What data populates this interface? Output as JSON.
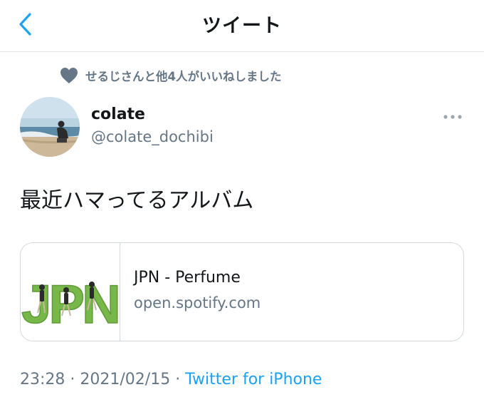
{
  "header": {
    "title": "ツイート"
  },
  "liked_by": {
    "text": "せるじさんと他4人がいいねしました"
  },
  "author": {
    "display_name": "colate",
    "handle": "@colate_dochibi"
  },
  "tweet": {
    "text": "最近ハマってるアルバム"
  },
  "card": {
    "thumbnail_text": "JPN",
    "title": "JPN - Perfume",
    "domain": "open.spotify.com"
  },
  "meta": {
    "time": "23:28",
    "separator": "·",
    "date": "2021/02/15",
    "source": "Twitter for iPhone"
  },
  "colors": {
    "accent": "#1da1f2",
    "secondary": "#657786",
    "border": "#d3d9de",
    "jpn_green": "#78b84a"
  },
  "icons": {
    "back": "chevron-left-icon",
    "liked": "heart-icon",
    "more": "more-horizontal-icon"
  }
}
